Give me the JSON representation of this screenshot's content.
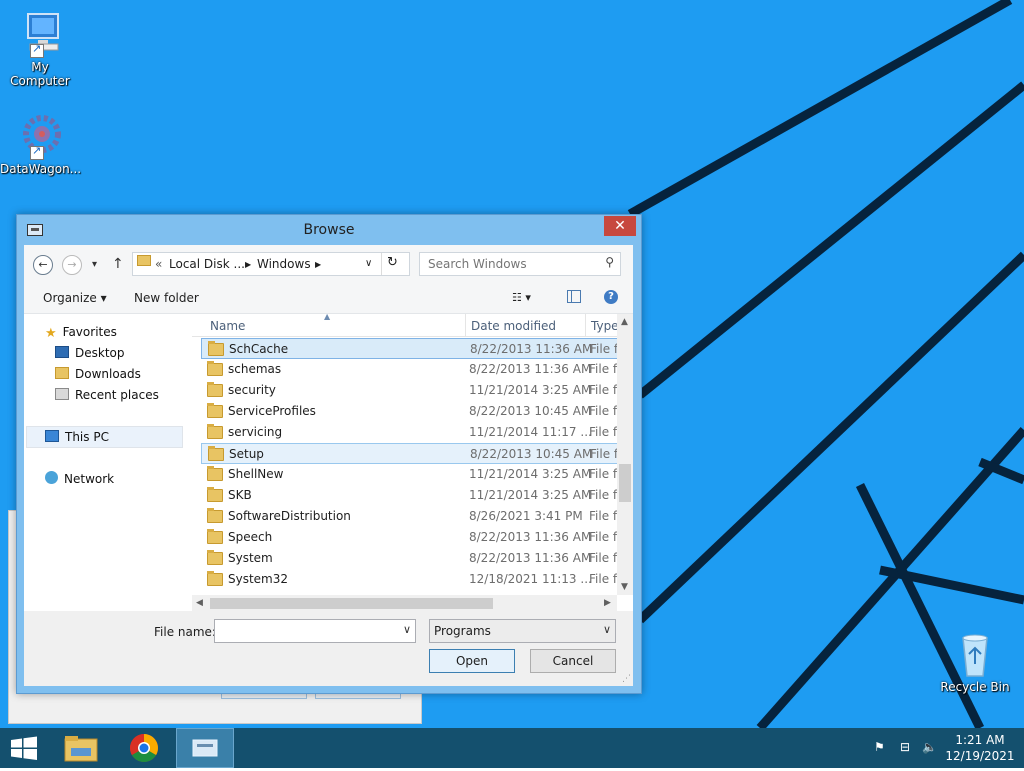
{
  "desktop": {
    "icons": [
      {
        "label": "My Computer"
      },
      {
        "label": "DataWagon..."
      },
      {
        "label": "Recycle Bin"
      }
    ]
  },
  "dialog": {
    "title": "Browse",
    "close_glyph": "✕",
    "breadcrumb": [
      "Local Disk ...",
      "Windows"
    ],
    "breadcrumb_prefix": "«",
    "search_placeholder": "Search Windows",
    "toolbar": {
      "organize": "Organize",
      "new_folder": "New folder"
    },
    "nav": {
      "favorites": "Favorites",
      "desktop": "Desktop",
      "downloads": "Downloads",
      "recent": "Recent places",
      "this_pc": "This PC",
      "network": "Network"
    },
    "columns": {
      "name": "Name",
      "date": "Date modified",
      "type": "Type"
    },
    "rows": [
      {
        "name": "SchCache",
        "date": "8/22/2013 11:36 AM",
        "type": "File fol"
      },
      {
        "name": "schemas",
        "date": "8/22/2013 11:36 AM",
        "type": "File fol"
      },
      {
        "name": "security",
        "date": "11/21/2014 3:25 AM",
        "type": "File fol"
      },
      {
        "name": "ServiceProfiles",
        "date": "8/22/2013 10:45 AM",
        "type": "File fol"
      },
      {
        "name": "servicing",
        "date": "11/21/2014 11:17 ...",
        "type": "File fol"
      },
      {
        "name": "Setup",
        "date": "8/22/2013 10:45 AM",
        "type": "File fol"
      },
      {
        "name": "ShellNew",
        "date": "11/21/2014 3:25 AM",
        "type": "File fol"
      },
      {
        "name": "SKB",
        "date": "11/21/2014 3:25 AM",
        "type": "File fol"
      },
      {
        "name": "SoftwareDistribution",
        "date": "8/26/2021 3:41 PM",
        "type": "File fol"
      },
      {
        "name": "Speech",
        "date": "8/22/2013 11:36 AM",
        "type": "File fol"
      },
      {
        "name": "System",
        "date": "8/22/2013 11:36 AM",
        "type": "File fol"
      },
      {
        "name": "System32",
        "date": "12/18/2021 11:13 ...",
        "type": "File fol"
      }
    ],
    "file_name_label": "File name:",
    "file_name_value": "",
    "filter_value": "Programs",
    "open_label": "Open",
    "cancel_label": "Cancel"
  },
  "taskbar": {
    "time": "1:21 AM",
    "date": "12/19/2021"
  },
  "colors": {
    "desktop": "#1e9cf2",
    "taskbar": "#14506e",
    "dialog_frame": "#7fbfef",
    "close": "#c7483e"
  }
}
